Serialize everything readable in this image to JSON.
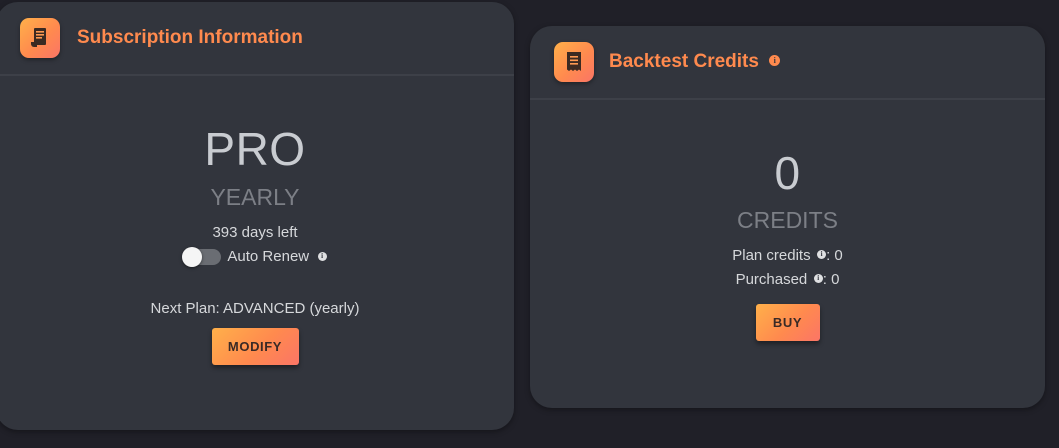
{
  "subscription": {
    "title": "Subscription Information",
    "plan": "PRO",
    "period": "YEARLY",
    "days_left": "393 days left",
    "auto_renew_label": "Auto Renew",
    "auto_renew_enabled": false,
    "next_plan": "Next Plan: ADVANCED (yearly)",
    "modify_label": "MODIFY"
  },
  "backtest": {
    "title": "Backtest Credits",
    "credits_value": "0",
    "credits_label": "CREDITS",
    "plan_credits_label": "Plan credits",
    "plan_credits_value": ": 0",
    "purchased_label": "Purchased",
    "purchased_value": ": 0",
    "buy_label": "BUY"
  },
  "icons": {
    "info_glyph": "i",
    "subscription_icon": "receipt-icon",
    "backtest_icon": "document-icon"
  },
  "colors": {
    "background": "#202028",
    "card": "#32353d",
    "accent": "#ff8a4e"
  }
}
